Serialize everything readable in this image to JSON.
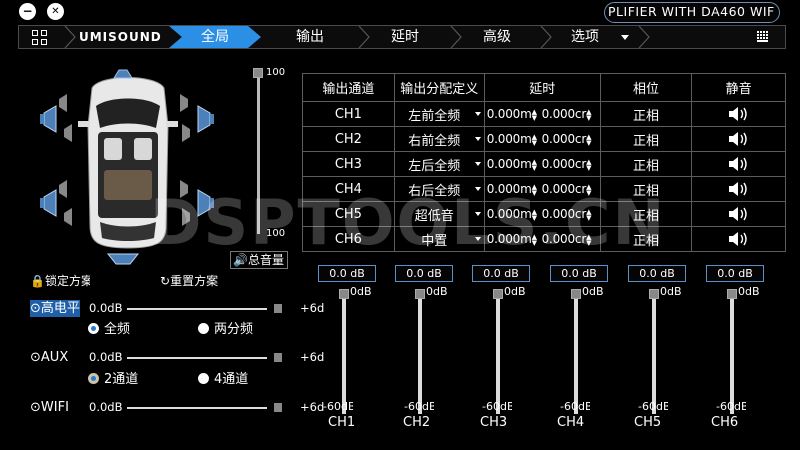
{
  "window": {
    "minimize_glyph": "−",
    "close_glyph": "✕",
    "title": "PLIFIER WITH DA460 WIF"
  },
  "nav": {
    "brand": "UMISOUND",
    "tabs": [
      "全局",
      "输出",
      "延时",
      "高级",
      "选项"
    ],
    "active_tab": "全局"
  },
  "volume": {
    "top_label": "100",
    "bottom_label": "100",
    "total_label": "总音量"
  },
  "car": {
    "lock_label": "锁定方案",
    "reset_label": "重置方案"
  },
  "sources": [
    {
      "name": "高电平",
      "icon": "radio-dot-icon",
      "min": "0.0dB",
      "max": "+6d",
      "active": true,
      "options": [
        {
          "label": "全频",
          "selected": true
        },
        {
          "label": "两分频",
          "selected": false
        }
      ]
    },
    {
      "name": "AUX",
      "icon": "radio-dot-icon",
      "min": "0.0dB",
      "max": "+6d",
      "active": false,
      "options": [
        {
          "label": "2通道",
          "selected": true
        },
        {
          "label": "4通道",
          "selected": false
        }
      ]
    },
    {
      "name": "WIFI",
      "icon": "radio-dot-icon",
      "min": "0.0dB",
      "max": "+6d",
      "active": false,
      "options": []
    }
  ],
  "table": {
    "headers": [
      "输出通道",
      "输出分配定义",
      "延时",
      "相位",
      "静音"
    ],
    "rows": [
      {
        "ch": "CH1",
        "alloc": "左前全频",
        "delay_m": "0.000m",
        "delay_cm": "0.000cr",
        "phase": "正相"
      },
      {
        "ch": "CH2",
        "alloc": "右前全频",
        "delay_m": "0.000m",
        "delay_cm": "0.000cr",
        "phase": "正相"
      },
      {
        "ch": "CH3",
        "alloc": "左后全频",
        "delay_m": "0.000m",
        "delay_cm": "0.000cr",
        "phase": "正相"
      },
      {
        "ch": "CH4",
        "alloc": "右后全频",
        "delay_m": "0.000m",
        "delay_cm": "0.000cr",
        "phase": "正相"
      },
      {
        "ch": "CH5",
        "alloc": "超低音",
        "delay_m": "0.000m",
        "delay_cm": "0.000cr",
        "phase": "正相"
      },
      {
        "ch": "CH6",
        "alloc": "中置",
        "delay_m": "0.000m",
        "delay_cm": "0.000cr",
        "phase": "正相"
      }
    ]
  },
  "faders": [
    {
      "name": "CH1",
      "value": "0.0 dB",
      "top": "0dB",
      "bottom": "-60dB"
    },
    {
      "name": "CH2",
      "value": "0.0 dB",
      "top": "0dB",
      "bottom": "-60dB"
    },
    {
      "name": "CH3",
      "value": "0.0 dB",
      "top": "0dB",
      "bottom": "-60dB"
    },
    {
      "name": "CH4",
      "value": "0.0 dB",
      "top": "0dB",
      "bottom": "-60dB"
    },
    {
      "name": "CH5",
      "value": "0.0 dB",
      "top": "0dB",
      "bottom": "-60dB"
    },
    {
      "name": "CH6",
      "value": "0.0 dB",
      "top": "0dB",
      "bottom": "-60dB"
    }
  ],
  "watermark": "DSPTOOLS.CN",
  "colors": {
    "accent": "#2b8fe5",
    "active_source": "#1f5fa8",
    "border": "#5c5c5c"
  }
}
